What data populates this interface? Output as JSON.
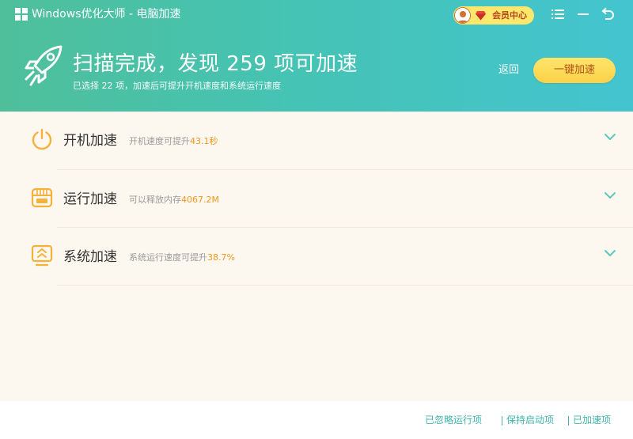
{
  "titlebar": {
    "app_title": "Windows优化大师 - 电脑加速",
    "vip_label": "会员中心"
  },
  "summary": {
    "headline": "扫描完成，发现 259 项可加速",
    "subline": "已选择 22 项，加速后可提升开机速度和系统运行速度",
    "back_label": "返回",
    "boost_label": "一键加速"
  },
  "items": [
    {
      "name": "开机加速",
      "desc_prefix": "开机速度可提升",
      "desc_value": "43.1秒",
      "icon": "power-icon"
    },
    {
      "name": "运行加速",
      "desc_prefix": "可以释放内存",
      "desc_value": "4067.2M",
      "icon": "memory-icon"
    },
    {
      "name": "系统加速",
      "desc_prefix": "系统运行速度可提升",
      "desc_value": "38.7%",
      "icon": "system-speed-icon"
    }
  ],
  "footer": {
    "ignored_label": "已忽略运行项",
    "kept_label": "保持启动项",
    "boosted_label": "已加速项"
  },
  "colors": {
    "header_start": "#4fbf9a",
    "header_end": "#44c4cf",
    "accent_orange": "#f0961f",
    "icon_orange": "#f5b13a",
    "link_teal": "#3fb5ad",
    "chevron_teal": "#5ec6bc",
    "button_yellow": "#fbd148"
  }
}
